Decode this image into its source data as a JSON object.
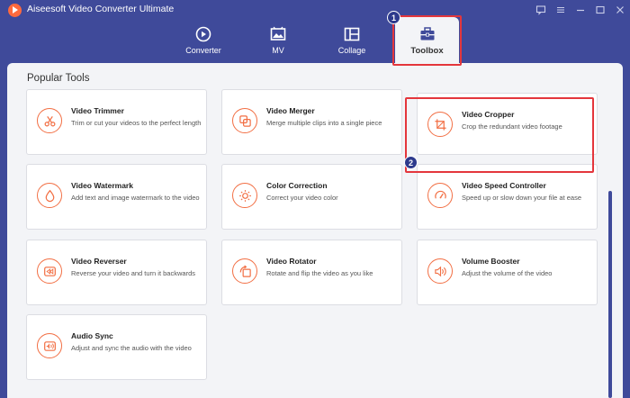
{
  "app": {
    "title": "Aiseesoft Video Converter Ultimate"
  },
  "window_controls": [
    {
      "icon": "feedback-icon"
    },
    {
      "icon": "menu-icon"
    },
    {
      "icon": "minimize-icon"
    },
    {
      "icon": "maximize-icon"
    },
    {
      "icon": "close-icon"
    }
  ],
  "nav": {
    "tabs": [
      {
        "label": "Converter",
        "icon": "converter-icon"
      },
      {
        "label": "MV",
        "icon": "mv-icon"
      },
      {
        "label": "Collage",
        "icon": "collage-icon"
      },
      {
        "label": "Toolbox",
        "icon": "toolbox-icon",
        "selected": true
      }
    ]
  },
  "annotations": {
    "badge1": "1",
    "badge2": "2",
    "highlight_color": "#e4363c"
  },
  "section": {
    "title": "Popular Tools"
  },
  "tools": [
    {
      "title": "Video Trimmer",
      "desc": "Trim or cut your videos to the perfect length",
      "icon": "scissors-icon"
    },
    {
      "title": "Video Merger",
      "desc": "Merge multiple clips into a single piece",
      "icon": "merge-icon"
    },
    {
      "title": "Video Cropper",
      "desc": "Crop the redundant video footage",
      "icon": "crop-icon"
    },
    {
      "title": "Video Watermark",
      "desc": "Add text and image watermark to the video",
      "icon": "droplet-icon"
    },
    {
      "title": "Color Correction",
      "desc": "Correct your video color",
      "icon": "sun-icon"
    },
    {
      "title": "Video Speed Controller",
      "desc": "Speed up or slow down your file at ease",
      "icon": "speedometer-icon"
    },
    {
      "title": "Video Reverser",
      "desc": "Reverse your video and turn it backwards",
      "icon": "rewind-icon"
    },
    {
      "title": "Video Rotator",
      "desc": "Rotate and flip the video as you like",
      "icon": "rotate-icon"
    },
    {
      "title": "Volume Booster",
      "desc": "Adjust the volume of the video",
      "icon": "volume-icon"
    },
    {
      "title": "Audio Sync",
      "desc": "Adjust and sync the audio with the video",
      "icon": "audio-sync-icon"
    }
  ],
  "colors": {
    "accent": "#f26f44",
    "header_bg": "#3f4a9a",
    "panel_bg": "#f3f4f7"
  }
}
